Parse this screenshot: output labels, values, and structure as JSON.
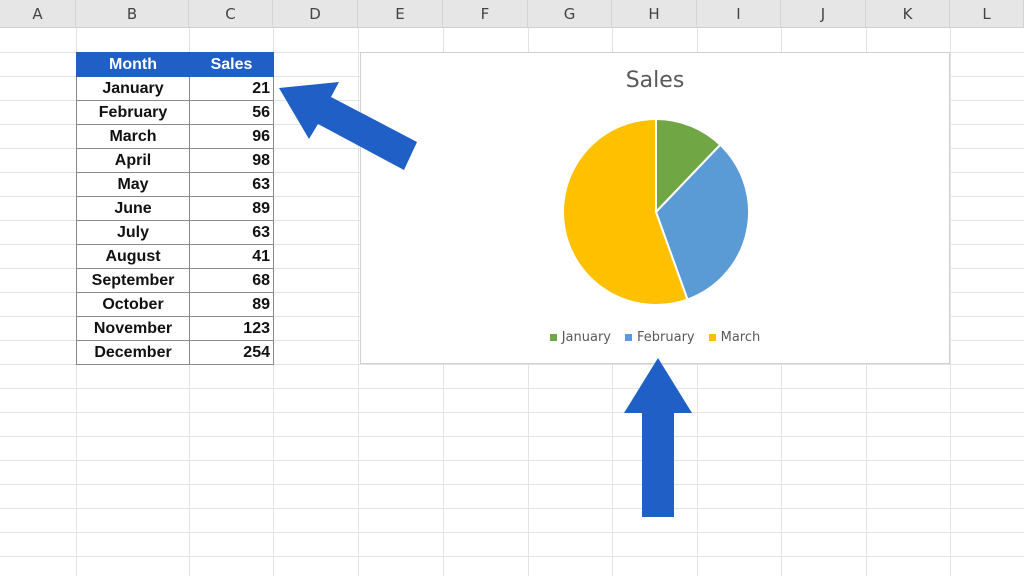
{
  "columns": [
    "A",
    "B",
    "C",
    "D",
    "E",
    "F",
    "G",
    "H",
    "I",
    "J",
    "K",
    "L"
  ],
  "table": {
    "headers": [
      "Month",
      "Sales"
    ],
    "rows": [
      {
        "month": "January",
        "sales": "21"
      },
      {
        "month": "February",
        "sales": "56"
      },
      {
        "month": "March",
        "sales": "96"
      },
      {
        "month": "April",
        "sales": "98"
      },
      {
        "month": "May",
        "sales": "63"
      },
      {
        "month": "June",
        "sales": "89"
      },
      {
        "month": "July",
        "sales": "63"
      },
      {
        "month": "August",
        "sales": "41"
      },
      {
        "month": "September",
        "sales": "68"
      },
      {
        "month": "October",
        "sales": "89"
      },
      {
        "month": "November",
        "sales": "123"
      },
      {
        "month": "December",
        "sales": "254"
      }
    ]
  },
  "chart_data": {
    "type": "pie",
    "title": "Sales",
    "categories": [
      "January",
      "February",
      "March"
    ],
    "values": [
      21,
      56,
      96
    ],
    "colors": [
      "#70a644",
      "#5b9bd5",
      "#ffc000"
    ],
    "legend_position": "bottom"
  },
  "annotations": {
    "arrow_color": "#1f5fc6"
  }
}
